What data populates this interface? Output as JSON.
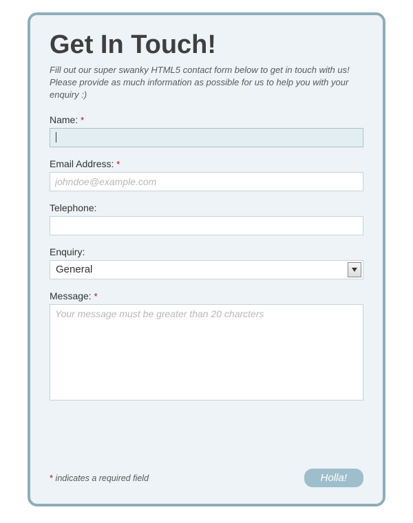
{
  "header": {
    "title": "Get In Touch!",
    "subtitle": "Fill out our super swanky HTML5 contact form below to get in touch with us! Please provide as much information as possible for us to help you with your enquiry :)"
  },
  "fields": {
    "name": {
      "label": "Name:",
      "required": true,
      "value": ""
    },
    "email": {
      "label": "Email Address:",
      "required": true,
      "placeholder": "johndoe@example.com",
      "value": ""
    },
    "telephone": {
      "label": "Telephone:",
      "required": false,
      "value": ""
    },
    "enquiry": {
      "label": "Enquiry:",
      "required": false,
      "selected": "General"
    },
    "message": {
      "label": "Message:",
      "required": true,
      "placeholder": "Your message must be greater than 20 charcters",
      "value": ""
    }
  },
  "footer": {
    "required_mark": "*",
    "required_note": " indicates a required field",
    "submit_label": "Holla!"
  },
  "symbols": {
    "req": "*"
  }
}
